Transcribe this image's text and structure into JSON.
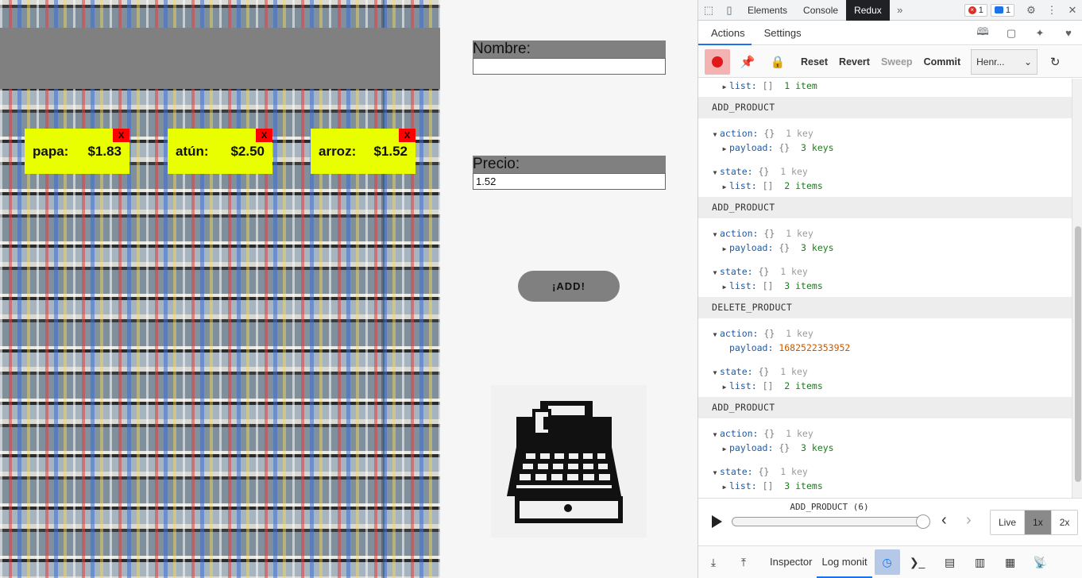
{
  "app": {
    "products": [
      {
        "name": "papa:",
        "price": "$1.83",
        "delete_label": "X"
      },
      {
        "name": "atún:",
        "price": "$2.50",
        "delete_label": "X"
      },
      {
        "name": "arroz:",
        "price": "$1.52",
        "delete_label": "X"
      }
    ],
    "form": {
      "name_label": "Nombre:",
      "name_value": "",
      "price_label": "Precio:",
      "price_value": "1.52",
      "add_label": "¡ADD!"
    }
  },
  "devtools": {
    "tabs": [
      "Elements",
      "Console",
      "Redux"
    ],
    "active_tab": "Redux",
    "more_label": "»",
    "error_count": "1",
    "message_count": "1",
    "subtabs": [
      "Actions",
      "Settings"
    ],
    "toolbar": {
      "reset": "Reset",
      "revert": "Revert",
      "sweep": "Sweep",
      "commit": "Commit",
      "instance": "Henr..."
    },
    "log": {
      "top_list_count": "1 item",
      "entries": [
        {
          "type": "ADD_PRODUCT",
          "payload_count": "3 keys",
          "list_count": "2 items"
        },
        {
          "type": "ADD_PRODUCT",
          "payload_count": "3 keys",
          "list_count": "3 items"
        },
        {
          "type": "DELETE_PRODUCT",
          "payload_value": "1682522353952",
          "list_count": "2 items"
        },
        {
          "type": "ADD_PRODUCT",
          "payload_count": "3 keys",
          "list_count": "3 items"
        }
      ],
      "key_action": "action:",
      "key_payload": "payload:",
      "key_state": "state:",
      "key_list": "list:",
      "obj_brace": "{}",
      "arr_brace": "[]",
      "one_key": "1 key"
    },
    "slider": {
      "current_action": "ADD_PRODUCT (6)",
      "position": 1.0,
      "speeds": [
        "Live",
        "1x",
        "2x"
      ],
      "active_speed": "1x"
    },
    "bottom_tabs": {
      "inspector": "Inspector",
      "log_monitor": "Log monit"
    }
  }
}
